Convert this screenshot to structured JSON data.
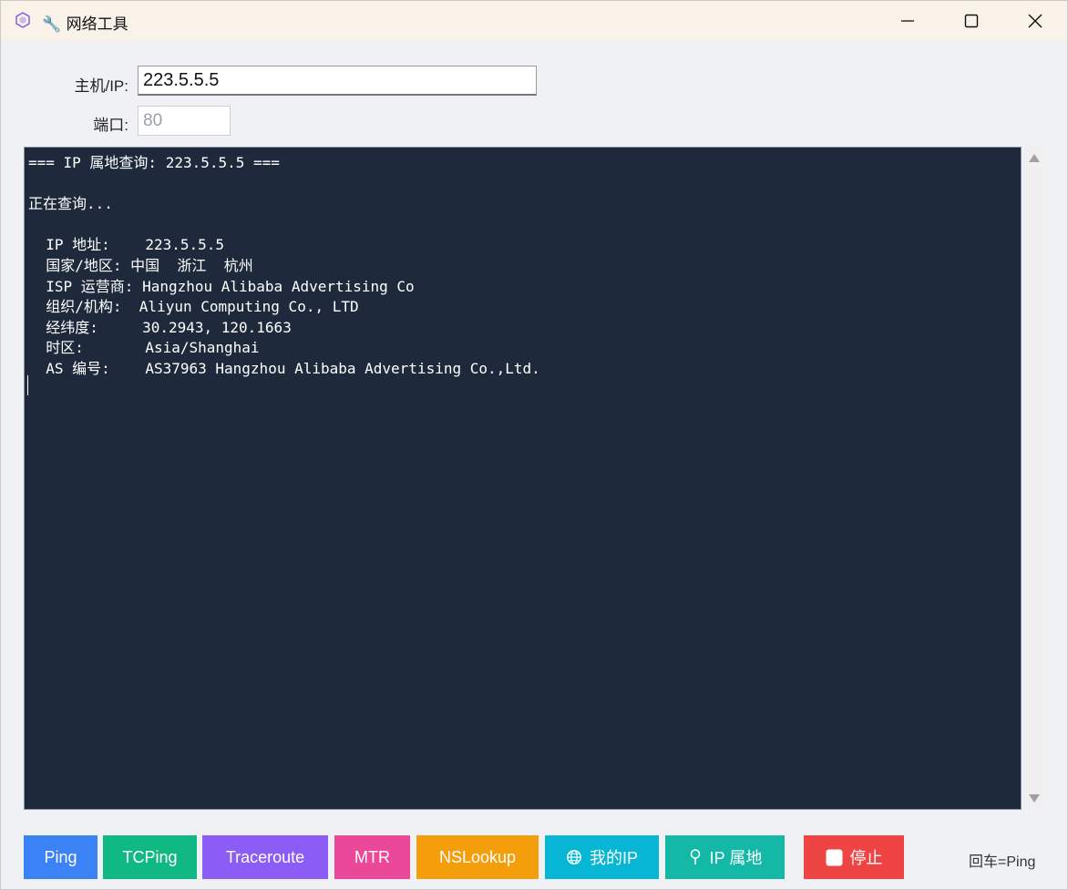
{
  "window": {
    "title": "🔧 网络工具",
    "controls": [
      "minimize-icon",
      "maximize-icon",
      "close-icon"
    ]
  },
  "form": {
    "host_label": "主机/IP:",
    "host_value": "223.5.5.5",
    "port_label": "端口:",
    "port_placeholder": "80"
  },
  "terminal": {
    "background": "#1e293b",
    "text": "=== IP 属地查询: 223.5.5.5 ===\n\n正在查询...\n\n  IP 地址:    223.5.5.5\n  国家/地区: 中国  浙江  杭州\n  ISP 运营商: Hangzhou Alibaba Advertising Co\n  组织/机构:  Aliyun Computing Co., LTD\n  经纬度:     30.2943, 120.1663\n  时区:       Asia/Shanghai\n  AS 编号:    AS37963 Hangzhou Alibaba Advertising Co.,Ltd."
  },
  "buttons": [
    {
      "label": "Ping",
      "color": "#3b82f6",
      "icon": ""
    },
    {
      "label": "TCPing",
      "color": "#10b981",
      "icon": ""
    },
    {
      "label": "Traceroute",
      "color": "#8b5cf6",
      "icon": ""
    },
    {
      "label": "MTR",
      "color": "#ec4899",
      "icon": ""
    },
    {
      "label": "NSLookup",
      "color": "#f59e0b",
      "icon": ""
    },
    {
      "label": "我的IP",
      "color": "#06b6d4",
      "icon": "globe-icon"
    },
    {
      "label": "IP 属地",
      "color": "#14b8a6",
      "icon": "pin-icon"
    },
    {
      "label": "停止",
      "color": "#ef4444",
      "icon": "stop-icon"
    }
  ],
  "hint": "回车=Ping"
}
